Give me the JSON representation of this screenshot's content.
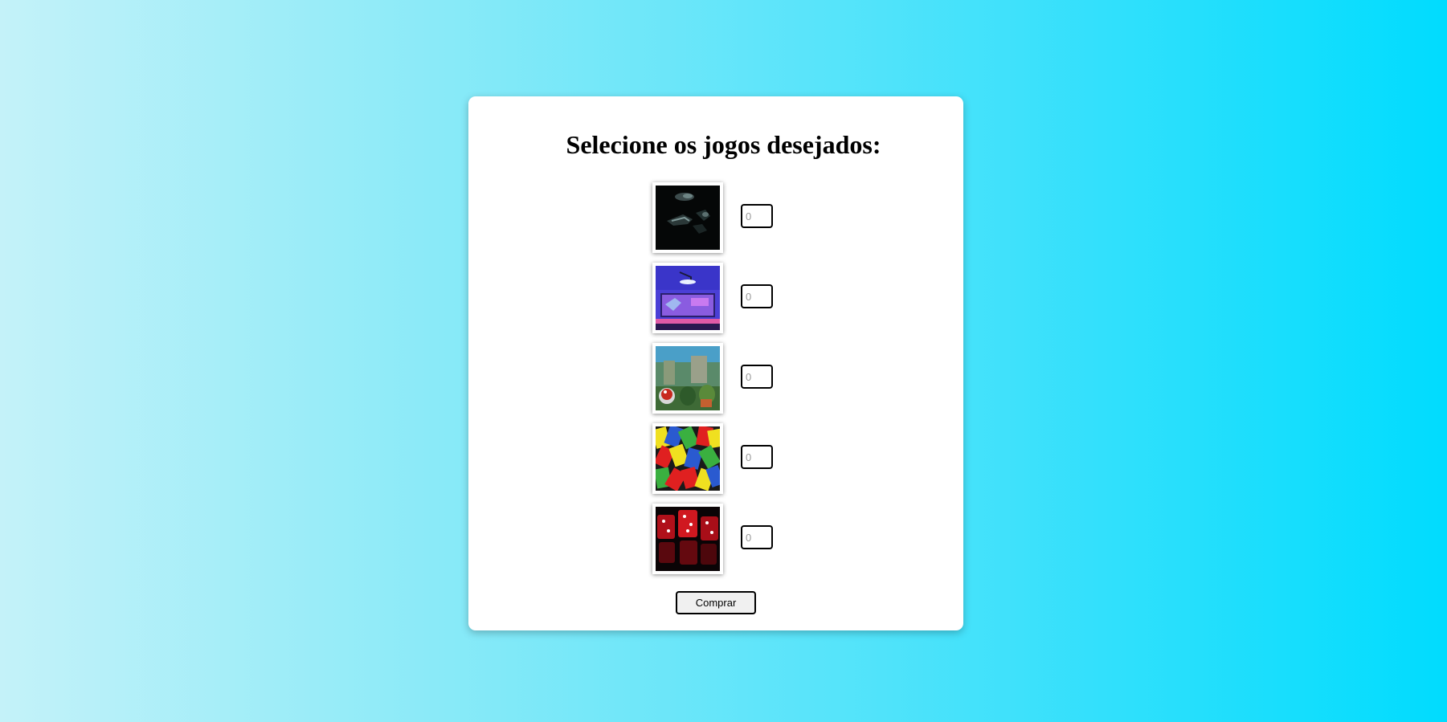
{
  "page": {
    "title": "Selecione os jogos desejados:"
  },
  "games": [
    {
      "icon": "soldiers-game-thumbnail",
      "quantity_placeholder": "0"
    },
    {
      "icon": "gaming-setup-game-thumbnail",
      "quantity_placeholder": "0"
    },
    {
      "icon": "adventure-game-thumbnail",
      "quantity_placeholder": "0"
    },
    {
      "icon": "uno-cards-game-thumbnail",
      "quantity_placeholder": "0"
    },
    {
      "icon": "red-dice-game-thumbnail",
      "quantity_placeholder": "0"
    }
  ],
  "actions": {
    "buy_label": "Comprar"
  },
  "colors": {
    "background_left": "#c4f2f9",
    "background_right": "#00dcfe",
    "card": "#ffffff"
  }
}
